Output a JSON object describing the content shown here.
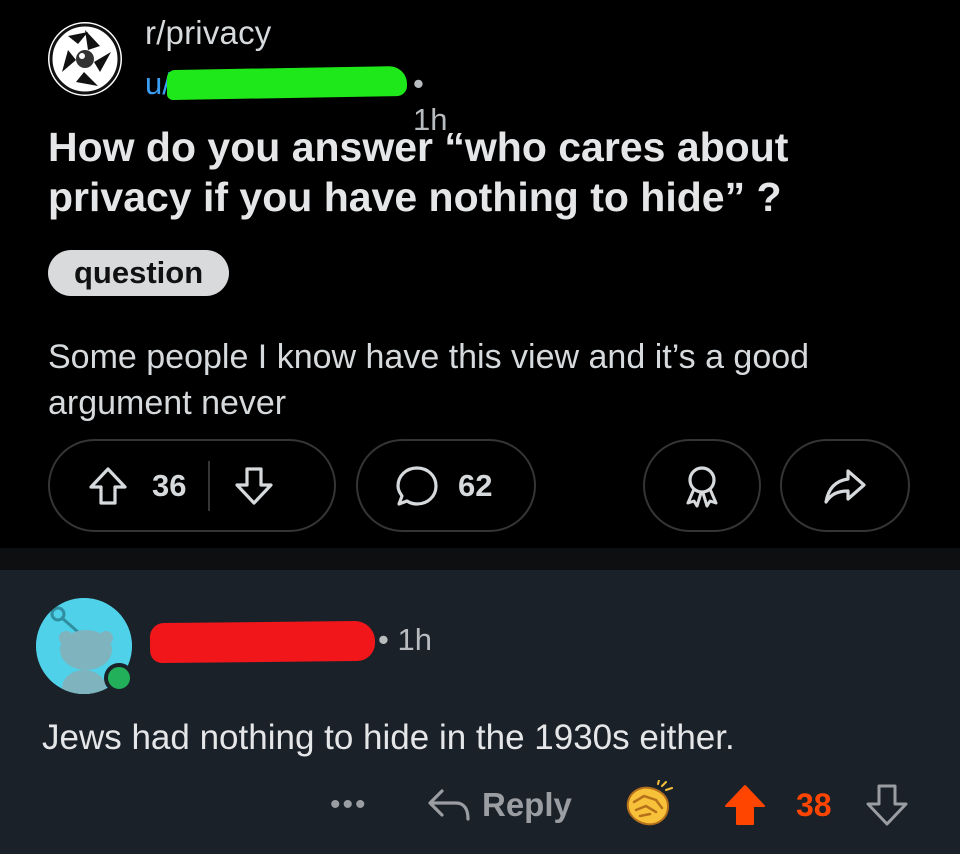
{
  "post": {
    "subreddit": "r/privacy",
    "user_prefix": "u/",
    "time": "• 1h",
    "title": "How do you answer  “who cares about privacy if you have nothing to hide” ?",
    "flair": "question",
    "body": "Some people I know have this view and it’s a good argument never",
    "upvotes": "36",
    "comments": "62",
    "icons": {
      "upvote": "arrow-up-outline-icon",
      "downvote": "arrow-down-outline-icon",
      "comment": "speech-bubble-icon",
      "award": "award-ribbon-icon",
      "share": "share-arrow-icon"
    }
  },
  "comment": {
    "time": "• 1h",
    "text": "Jews had nothing to hide in the 1930s either.",
    "more": "•••",
    "reply_label": "Reply",
    "score": "38",
    "icons": {
      "avatar": "snoo-avatar-icon",
      "online": "online-dot-icon",
      "reply": "reply-arrow-icon",
      "award": "handshake-emoji-icon",
      "upvote": "arrow-up-filled-icon",
      "downvote": "arrow-down-outline-icon"
    }
  },
  "colors": {
    "redaction_username": "#1ee81a",
    "redaction_commenter": "#f0161a",
    "upvoted": "#ff4500",
    "link_blue": "#3a9ff2"
  }
}
